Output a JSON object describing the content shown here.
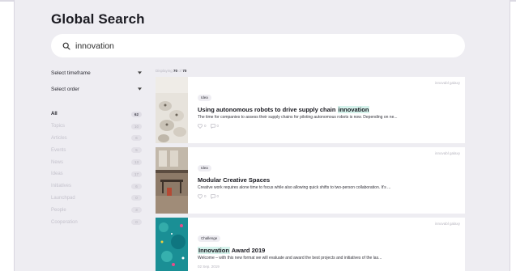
{
  "page": {
    "title": "Global Search"
  },
  "search": {
    "value": "innovation",
    "icon": "search-icon"
  },
  "filters": {
    "timeframe_label": "Select timeframe",
    "order_label": "Select order"
  },
  "categories": [
    {
      "label": "All",
      "count": "62"
    },
    {
      "label": "Topics",
      "count": "10"
    },
    {
      "label": "Articles",
      "count": "6"
    },
    {
      "label": "Events",
      "count": "5"
    },
    {
      "label": "News",
      "count": "13"
    },
    {
      "label": "Ideas",
      "count": "17"
    },
    {
      "label": "Initiatives",
      "count": "6"
    },
    {
      "label": "Launchpad",
      "count": "0"
    },
    {
      "label": "People",
      "count": "3"
    },
    {
      "label": "Cooperation",
      "count": "0"
    }
  ],
  "results_summary": {
    "prefix": "Displaying",
    "shown": "70",
    "separator": "of",
    "total": "70"
  },
  "results": [
    {
      "source": "innovabl galaxy",
      "tag": "Idea",
      "title_before": "Using autonomous robots to drive supply chain ",
      "title_highlight": "innovation",
      "title_after": "",
      "description": "The time for companies to assess their supply chains for piloting autonomous robots is now. Depending on ne...",
      "likes": "0",
      "comments": "0"
    },
    {
      "source": "innovabl galaxy",
      "tag": "Idea",
      "title_before": "Modular Creative Spaces",
      "title_highlight": "",
      "title_after": "",
      "description": "Creative work requires alone time to focus while also allowing quick shifts to two-person collaboration. It's ...",
      "likes": "0",
      "comments": "0"
    },
    {
      "source": "innovabl galaxy",
      "tag": "Challenge",
      "title_before": "",
      "title_highlight": "Innovation",
      "title_after": " Award 2019",
      "description": "Welcome – with this new format we will evaluate and award the best projects and initiatives of the las...",
      "date": "02 Sep. 2019"
    }
  ],
  "colors": {
    "accent_highlight": "#d6f3ec",
    "background": "#eeedf2"
  }
}
